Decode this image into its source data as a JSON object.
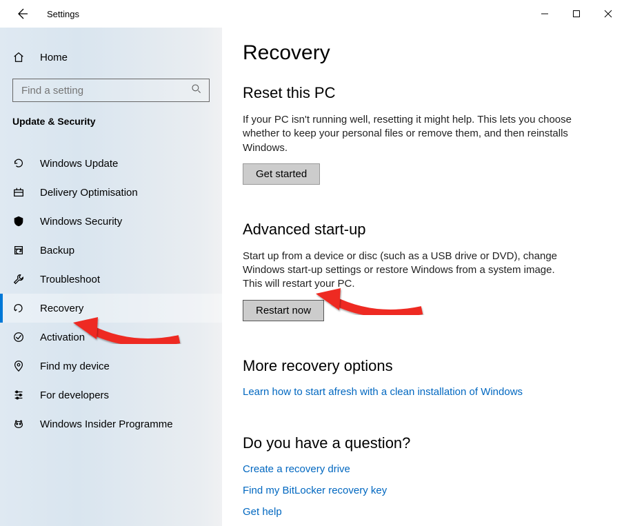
{
  "window": {
    "title": "Settings"
  },
  "sidebar": {
    "home": "Home",
    "search_placeholder": "Find a setting",
    "category": "Update & Security",
    "items": [
      {
        "label": "Windows Update"
      },
      {
        "label": "Delivery Optimisation"
      },
      {
        "label": "Windows Security"
      },
      {
        "label": "Backup"
      },
      {
        "label": "Troubleshoot"
      },
      {
        "label": "Recovery"
      },
      {
        "label": "Activation"
      },
      {
        "label": "Find my device"
      },
      {
        "label": "For developers"
      },
      {
        "label": "Windows Insider Programme"
      }
    ]
  },
  "page": {
    "title": "Recovery",
    "reset": {
      "heading": "Reset this PC",
      "body": "If your PC isn't running well, resetting it might help. This lets you choose whether to keep your personal files or remove them, and then reinstalls Windows.",
      "button": "Get started"
    },
    "advanced": {
      "heading": "Advanced start-up",
      "body": "Start up from a device or disc (such as a USB drive or DVD), change Windows start-up settings or restore Windows from a system image. This will restart your PC.",
      "button": "Restart now"
    },
    "more": {
      "heading": "More recovery options",
      "link": "Learn how to start afresh with a clean installation of Windows"
    },
    "question": {
      "heading": "Do you have a question?",
      "links": [
        "Create a recovery drive",
        "Find my BitLocker recovery key",
        "Get help"
      ]
    }
  }
}
